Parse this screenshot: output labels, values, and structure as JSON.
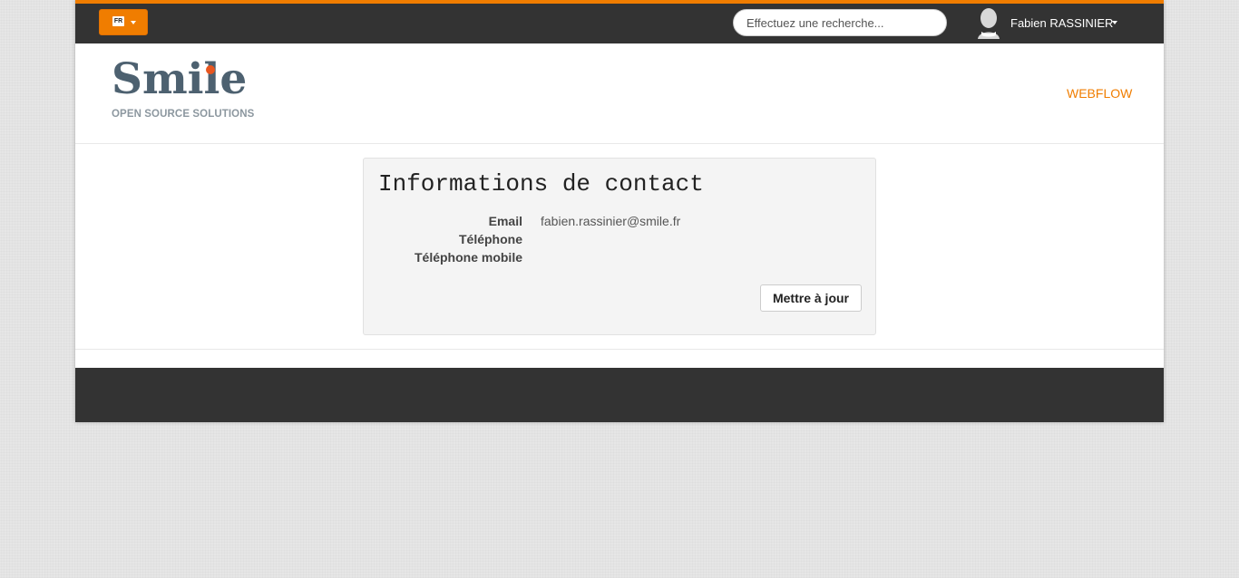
{
  "topbar": {
    "language": "FR",
    "search_placeholder": "Effectuez une recherche...",
    "user_name": "Fabien RASSINIER"
  },
  "header": {
    "logo_word": "Smile",
    "logo_tagline": "OPEN SOURCE SOLUTIONS",
    "nav_link": "WEBFLOW"
  },
  "contact": {
    "title": "Informations de contact",
    "fields": [
      {
        "label": "Email",
        "value": "fabien.rassinier@smile.fr"
      },
      {
        "label": "Téléphone",
        "value": ""
      },
      {
        "label": "Téléphone mobile",
        "value": ""
      }
    ],
    "update_button": "Mettre à jour"
  },
  "colors": {
    "accent": "#f07d00",
    "dark_bar": "#333333",
    "logo_text": "#4d6170",
    "logo_dot": "#e8561f"
  },
  "icons": [
    "flag-icon",
    "caret-down-icon",
    "user-avatar-icon"
  ]
}
